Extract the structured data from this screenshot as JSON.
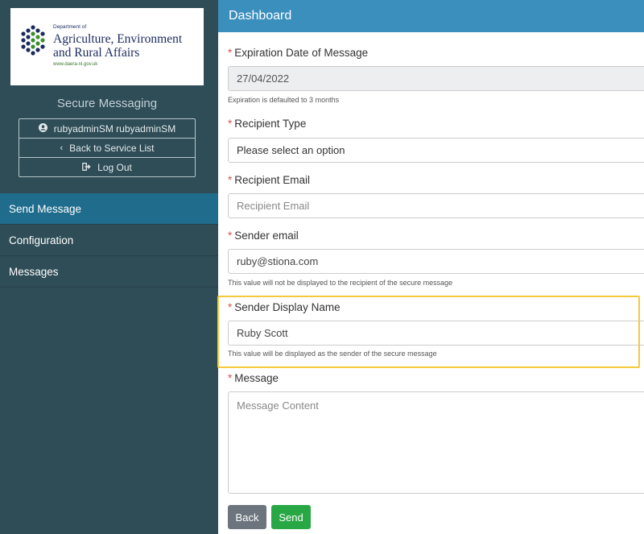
{
  "logo": {
    "department_of": "Department of",
    "name_line1": "Agriculture, Environment",
    "name_line2": "and Rural Affairs",
    "url": "www.daera-ni.gov.uk"
  },
  "app_title": "Secure Messaging",
  "user_box": {
    "username": "rubyadminSM rubyadminSM",
    "back_label": "Back to Service List",
    "logout_label": "Log Out"
  },
  "nav": {
    "items": [
      {
        "label": "Send Message",
        "active": true
      },
      {
        "label": "Configuration",
        "active": false
      },
      {
        "label": "Messages",
        "active": false
      }
    ]
  },
  "header": {
    "title": "Dashboard"
  },
  "form": {
    "required_marker": "*",
    "expiration": {
      "label": "Expiration Date of Message",
      "value": "27/04/2022",
      "hint": "Expiration is defaulted to 3 months"
    },
    "recipient_type": {
      "label": "Recipient Type",
      "value": "Please select an option"
    },
    "recipient_email": {
      "label": "Recipient Email",
      "placeholder": "Recipient Email"
    },
    "sender_email": {
      "label": "Sender email",
      "value": "ruby@stiona.com",
      "hint": "This value will not be displayed to the recipient of the secure message"
    },
    "sender_display_name": {
      "label": "Sender Display Name",
      "value": "Ruby Scott",
      "hint": "This value will be displayed as the sender of the secure message"
    },
    "message": {
      "label": "Message",
      "placeholder": "Message Content"
    }
  },
  "buttons": {
    "back": "Back",
    "send": "Send"
  },
  "colors": {
    "sidebar": "#2e4d57",
    "active_nav": "#1f6c8c",
    "header": "#3a8fbd",
    "send_button": "#28a745",
    "back_button": "#6c757d",
    "highlight": "#f6c93b",
    "required": "#d9534f"
  }
}
